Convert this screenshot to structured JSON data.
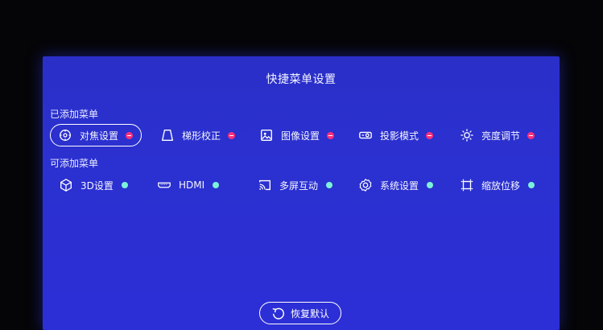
{
  "menu": {
    "title": "快捷菜单设置",
    "added_label": "已添加菜单",
    "addable_label": "可添加菜单",
    "added_items": [
      {
        "label": "对焦设置",
        "icon": "focus-icon",
        "focused": true
      },
      {
        "label": "梯形校正",
        "icon": "keystone-icon"
      },
      {
        "label": "图像设置",
        "icon": "image-icon"
      },
      {
        "label": "投影模式",
        "icon": "projector-icon"
      },
      {
        "label": "亮度调节",
        "icon": "brightness-icon"
      }
    ],
    "addable_items": [
      {
        "label": "3D设置",
        "icon": "cube-icon"
      },
      {
        "label": "HDMI",
        "icon": "hdmi-icon"
      },
      {
        "label": "多屏互动",
        "icon": "cast-icon"
      },
      {
        "label": "系统设置",
        "icon": "gear-icon"
      },
      {
        "label": "缩放位移",
        "icon": "zoom-shift-icon"
      }
    ],
    "reset_label": "恢复默认"
  },
  "colors": {
    "screen_bg": "#2b30d0",
    "remove_dot": "#ff2f7a",
    "add_dot": "#7cf2d8"
  }
}
